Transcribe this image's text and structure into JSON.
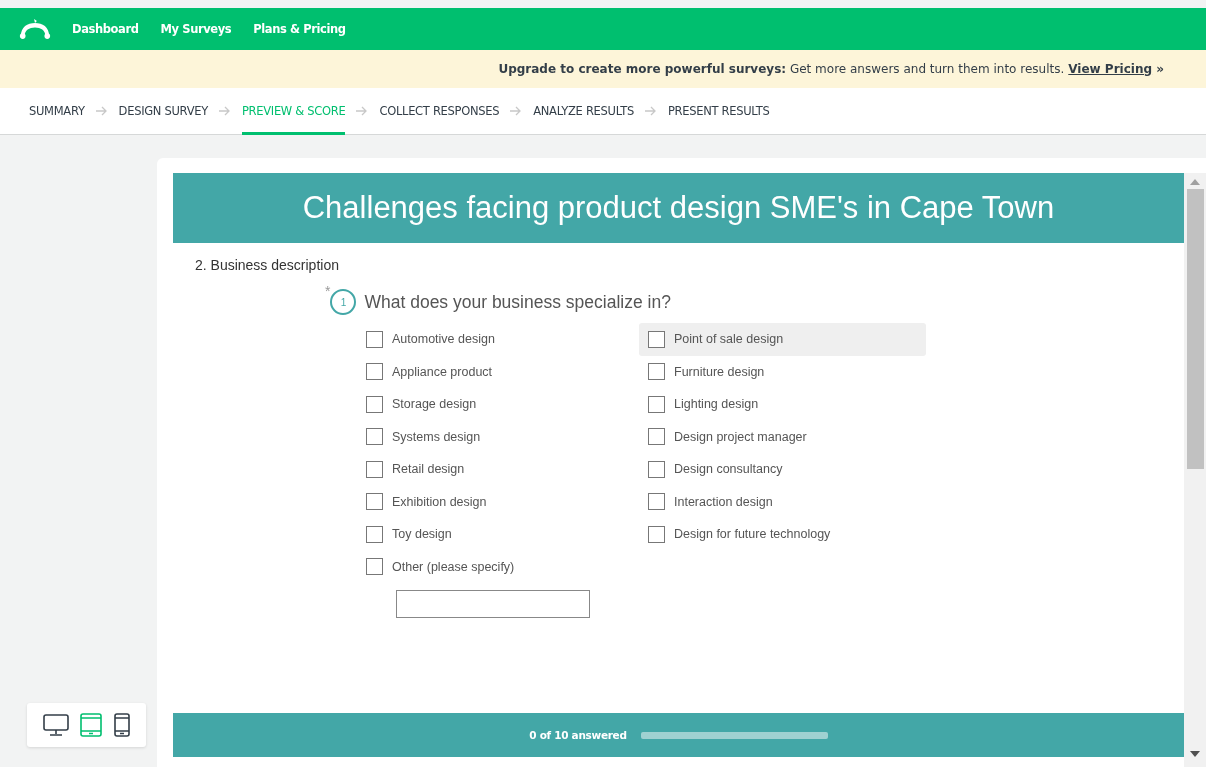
{
  "nav": {
    "links": [
      "Dashboard",
      "My Surveys",
      "Plans & Pricing"
    ]
  },
  "banner": {
    "text": "**Upgrade to create more powerful surveys:** Get more answers and turn them into results.",
    "link": "View Pricing",
    "link_suffix": "»"
  },
  "steps": [
    {
      "label": "SUMMARY",
      "selected": false
    },
    {
      "label": "DESIGN SURVEY",
      "selected": false
    },
    {
      "label": "PREVIEW & SCORE",
      "selected": true
    },
    {
      "label": "COLLECT RESPONSES",
      "selected": false
    },
    {
      "label": "ANALYZE RESULTS",
      "selected": false
    },
    {
      "label": "PRESENT RESULTS",
      "selected": false
    }
  ],
  "devices": [
    {
      "kind": "desktop",
      "selected": false
    },
    {
      "kind": "tablet",
      "selected": true
    },
    {
      "kind": "phone",
      "selected": false
    }
  ],
  "survey": {
    "title": "Challenges facing product design SME's in Cape Town",
    "page_title": "2. Business description",
    "question": {
      "required_mark": "*",
      "number": "1",
      "text": "What does your business specialize in?",
      "columns": [
        [
          {
            "label": "Automotive design",
            "checked": false,
            "hovered": false
          },
          {
            "label": "Appliance product",
            "checked": false,
            "hovered": false
          },
          {
            "label": "Storage design",
            "checked": false,
            "hovered": false
          },
          {
            "label": "Systems design",
            "checked": false,
            "hovered": false
          },
          {
            "label": "Retail design",
            "checked": false,
            "hovered": false
          },
          {
            "label": "Exhibition design",
            "checked": false,
            "hovered": false
          },
          {
            "label": "Toy design",
            "checked": false,
            "hovered": false
          },
          {
            "label": "Other (please specify)",
            "checked": false,
            "hovered": false
          }
        ],
        [
          {
            "label": "Point of sale design",
            "checked": false,
            "hovered": true
          },
          {
            "label": "Furniture design",
            "checked": false,
            "hovered": false
          },
          {
            "label": "Lighting design",
            "checked": false,
            "hovered": false
          },
          {
            "label": "Design project manager",
            "checked": false,
            "hovered": false
          },
          {
            "label": "Design consultancy",
            "checked": false,
            "hovered": false
          },
          {
            "label": "Interaction design",
            "checked": false,
            "hovered": false
          },
          {
            "label": "Design for future technology",
            "checked": false,
            "hovered": false
          }
        ]
      ]
    },
    "progress": {
      "text": "0 of 10 answered",
      "level": 0
    }
  }
}
